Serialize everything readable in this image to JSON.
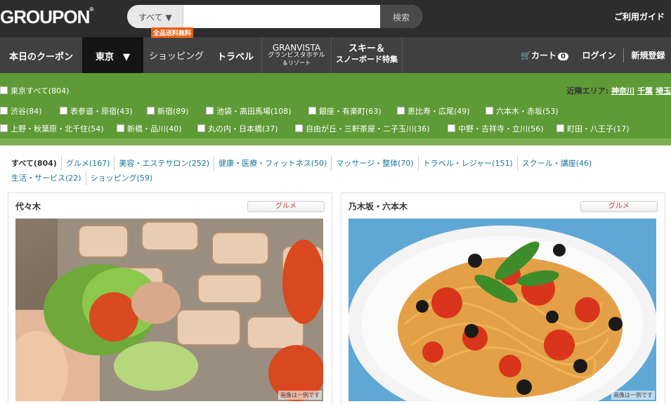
{
  "header": {
    "logo": "GROUPON",
    "search_category": "すべて ▼",
    "search_placeholder": "",
    "search_button": "検索",
    "guide": "ご利用ガイド"
  },
  "nav": {
    "today": "本日のクーポン",
    "city": "東京　▼",
    "shopping": "ショッピング",
    "shopping_badge": "全品送料無料",
    "travel": "トラベル",
    "granvista_en": "GRANVISTA",
    "granvista_jp": "グランビスタホテル",
    "granvista_jp2": "＆リゾート",
    "ski": "スキー＆",
    "ski2": "スノーボード特集",
    "cart": "カート",
    "cart_count": "0",
    "login": "ログイン",
    "register": "新規登録"
  },
  "areas": {
    "all": "東京すべて(804)",
    "near_label": "近隣エリア:",
    "near": [
      "神奈川",
      "千葉",
      "埼玉"
    ],
    "row1": [
      "渋谷(84)",
      "表参道・原宿(43)",
      "新宿(89)",
      "池袋・高田馬場(108)",
      "銀座・有楽町(63)",
      "恵比寿・広尾(49)",
      "六本木・赤坂(53)"
    ],
    "row2": [
      "上野・秋葉原・北千住(54)",
      "新橋・品川(40)",
      "丸の内・日本橋(37)",
      "自由が丘・三軒茶屋・二子玉川(36)",
      "中野・吉祥寺・立川(56)",
      "町田・八王子(17)"
    ]
  },
  "categories": [
    "すべて(804)",
    "グルメ(167)",
    "美容・エステサロン(252)",
    "健康・医療・フィットネス(50)",
    "マッサージ・整体(70)",
    "トラベル・レジャー(151)",
    "スクール・講座(46)",
    "生活・サービス(22)",
    "ショッピング(59)"
  ],
  "deals": [
    {
      "location": "代々木",
      "tag": "グルメ",
      "note": "画像は一例です"
    },
    {
      "location": "乃木坂・六本木",
      "tag": "グルメ",
      "note": "画像は一例です"
    }
  ]
}
